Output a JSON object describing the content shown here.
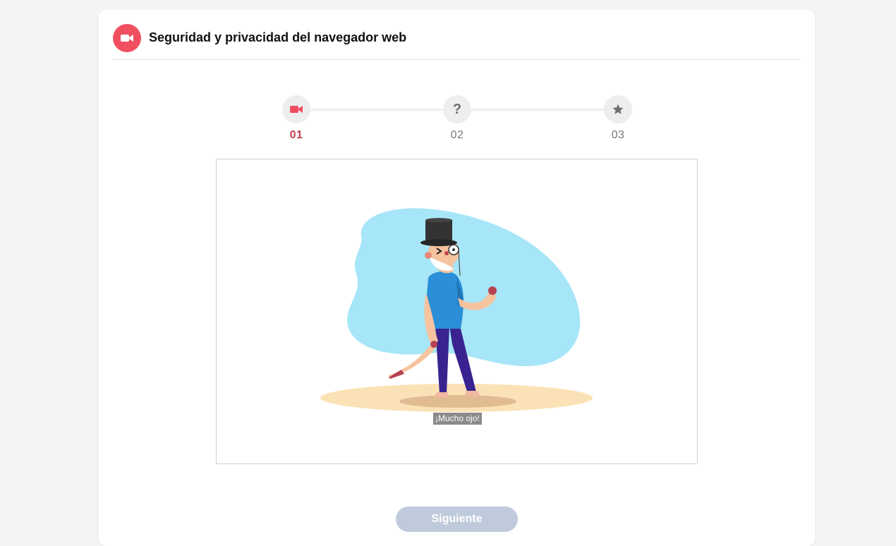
{
  "header": {
    "title": "Seguridad y privacidad del navegador web",
    "icon": "video-camera-icon",
    "accent_color": "#ef4f5f"
  },
  "stepper": {
    "steps": [
      {
        "number": "01",
        "icon": "video-camera-icon",
        "state": "active"
      },
      {
        "number": "02",
        "icon": "question-icon",
        "state": "inactive"
      },
      {
        "number": "03",
        "icon": "star-icon",
        "state": "inactive"
      }
    ],
    "active_color": "#c2404d",
    "inactive_color": "#777777"
  },
  "media": {
    "caption": "¡Mucho ojo!",
    "illustration": "man-with-top-hat-and-monocle"
  },
  "footer": {
    "next_label": "Siguiente",
    "next_state": "disabled",
    "button_color": "#bfcbdc"
  }
}
